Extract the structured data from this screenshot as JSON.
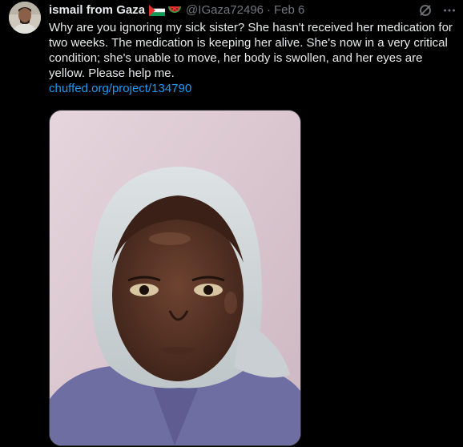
{
  "author": {
    "display_name": "ismail from Gaza",
    "badges": [
      "palestine-flag-icon",
      "watermelon-icon"
    ],
    "handle": "@IGaza72496",
    "separator": "·",
    "date": "Feb 6"
  },
  "tweet": {
    "text": "Why are you ignoring my sick sister? She hasn't received her medication for two weeks. The medication is keeping her alive. She's now in a very critical condition; she's unable to move, her body is swollen, and her eyes are yellow. Please help me.",
    "link": "chuffed.org/project/134790"
  },
  "colors": {
    "background": "#000000",
    "text": "#e7e9ea",
    "secondary": "#71767b",
    "link": "#1d9bf0"
  },
  "icons": {
    "grok": "grok-icon",
    "more": "more-icon"
  }
}
